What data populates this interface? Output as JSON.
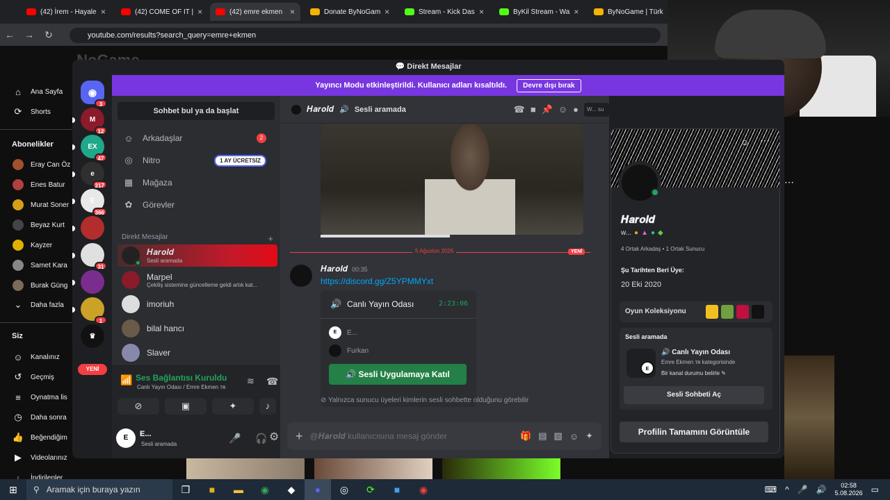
{
  "browser": {
    "tabs": [
      {
        "label": "(42) İrem - Hayale",
        "color": "#ff0000"
      },
      {
        "label": "(42) COME OF IT |",
        "color": "#ff0000"
      },
      {
        "label": "(42) emre ekmen",
        "color": "#ff0000"
      },
      {
        "label": "Donate ByNoGam",
        "color": "#f5b400"
      },
      {
        "label": "Stream - Kick Das",
        "color": "#53fc18"
      },
      {
        "label": "ByKil Stream - Wa",
        "color": "#53fc18"
      },
      {
        "label": "ByNoGame | Türk",
        "color": "#f5b400"
      }
    ],
    "url": "youtube.com/results?search_query=emre+ekmen"
  },
  "youtube": {
    "logo_overlay": "ByNoGame",
    "items": [
      {
        "label": "Ana Sayfa",
        "icon": "⌂"
      },
      {
        "label": "Shorts",
        "icon": "⟳"
      }
    ],
    "subs_title": "Abonelikler",
    "subs": [
      {
        "label": "Eray Can Öz",
        "color": "#a0522d"
      },
      {
        "label": "Enes Batur",
        "color": "#b0413e"
      },
      {
        "label": "Murat Soner",
        "color": "#d4a017"
      },
      {
        "label": "Beyaz Kurt",
        "color": "#444"
      },
      {
        "label": "Kayzer",
        "color": "#e0b000"
      },
      {
        "label": "Samet Kara",
        "color": "#888"
      },
      {
        "label": "Burak Güng",
        "color": "#7a6a5a"
      }
    ],
    "more": "Daha fazla",
    "you_title": "Siz",
    "you": [
      {
        "label": "Kanalınız",
        "icon": "☺"
      },
      {
        "label": "Geçmiş",
        "icon": "↺"
      },
      {
        "label": "Oynatma lis",
        "icon": "≡"
      },
      {
        "label": "Daha sonra",
        "icon": "◷"
      },
      {
        "label": "Beğendiğim",
        "icon": "👍"
      },
      {
        "label": "Videolarınız",
        "icon": "▶"
      },
      {
        "label": "İndirilenler",
        "icon": "↓"
      }
    ]
  },
  "discord": {
    "window_title": "Direkt Mesajlar",
    "streamer_mode": "Yayıncı Modu etkinleştirildi. Kullanıcı adları kısaltıldı.",
    "streamer_button": "Devre dışı bırak",
    "guilds": [
      {
        "text": "",
        "color": "#5865f2",
        "badge": "3"
      },
      {
        "text": "M",
        "color": "#8b1a2b",
        "badge": "12"
      },
      {
        "text": "EX",
        "color": "#1fa88a",
        "badge": "47"
      },
      {
        "text": "e",
        "color": "#2f2f2f",
        "badge": "217"
      },
      {
        "text": "E",
        "color": "#e8e8e8",
        "badge": "366"
      },
      {
        "text": "",
        "color": "#b32d2d",
        "badge": ""
      },
      {
        "text": "",
        "color": "#e0e0e0",
        "badge": "31"
      },
      {
        "text": "",
        "color": "#7b2d8e",
        "badge": ""
      },
      {
        "text": "",
        "color": "#c9a227",
        "badge": "1"
      },
      {
        "text": "♛",
        "color": "#111111",
        "badge": ""
      }
    ],
    "new_label": "YENİ",
    "search": "Sohbet bul ya da başlat",
    "nav": [
      {
        "label": "Arkadaşlar",
        "icon": "☺",
        "count": "2"
      },
      {
        "label": "Nitro",
        "icon": "◎",
        "tag": "1 AY ÜCRETSİZ"
      },
      {
        "label": "Mağaza",
        "icon": "▦"
      },
      {
        "label": "Görevler",
        "icon": "✿"
      }
    ],
    "dm_header": "Direkt Mesajlar",
    "dm_add": "+",
    "dms": [
      {
        "name": "𝑯𝒂𝒓𝒐𝒍𝒅",
        "sub": "Sesli aramada",
        "color": "#222",
        "selected": true
      },
      {
        "name": "Marpel",
        "sub": "Çekiliş sistemine güncelleme geldi artık kat...",
        "color": "#8b1a2b"
      },
      {
        "name": "imoriuh",
        "sub": "",
        "color": "#ddd"
      },
      {
        "name": "bilal hancı",
        "sub": "",
        "color": "#6a5a4a"
      },
      {
        "name": "Slaver",
        "sub": "",
        "color": "#8888aa"
      }
    ],
    "voice": {
      "status": "Ses Bağlantısı Kuruldu",
      "channel": "Canlı Yayın Odası / Emre Ekmen ᴛʀ"
    },
    "user": {
      "name": "E...",
      "status": "Sesli aramada"
    },
    "chat": {
      "name": "𝑯𝒂𝒓𝒐𝒍𝒅",
      "status": "Sesli aramada",
      "search": "W... su",
      "new_date": "5 Ağustos 2026",
      "new_tag": "YENİ",
      "msg_author": "𝑯𝒂𝒓𝒐𝒍𝒅",
      "msg_time": "00:35",
      "msg_link": "https://discord.gg/Z5YPMMYxt",
      "embed_title": "Canlı Yayın Odası",
      "embed_timer": "2:23:06",
      "embed_users": [
        "E...",
        "Furkan"
      ],
      "join": "Sesli Uygulamaya Katıl",
      "note": "Yalnızca sunucu üyeleri kimlerin sesli sohbette olduğunu görebilir",
      "composer": "@𝑯𝒂𝒓𝒐𝒍𝒅 kullanıcısına mesaj gönder"
    },
    "profile": {
      "name": "𝑯𝒂𝒓𝒐𝒍𝒅",
      "tag": "w...",
      "mutual": "4 Ortak Arkadaş • 1 Ortak Sunucu",
      "since_label": "Şu Tarihten Beri Üye:",
      "since": "20 Eki 2020",
      "games": "Oyun Koleksiyonu",
      "voice_label": "Sesli aramada",
      "voice_room": "Canlı Yayın Odası",
      "voice_cat": "Emre Ekmen ᴛʀ kategorisinde",
      "voice_status": "Bir kanal durumu belirle",
      "open_chat": "Sesli Sohbeti Aç",
      "full": "Profilin Tamamını Görüntüle"
    }
  },
  "taskbar": {
    "search": "Aramak için buraya yazın",
    "time": "02:58",
    "date": "5.08.2026"
  }
}
